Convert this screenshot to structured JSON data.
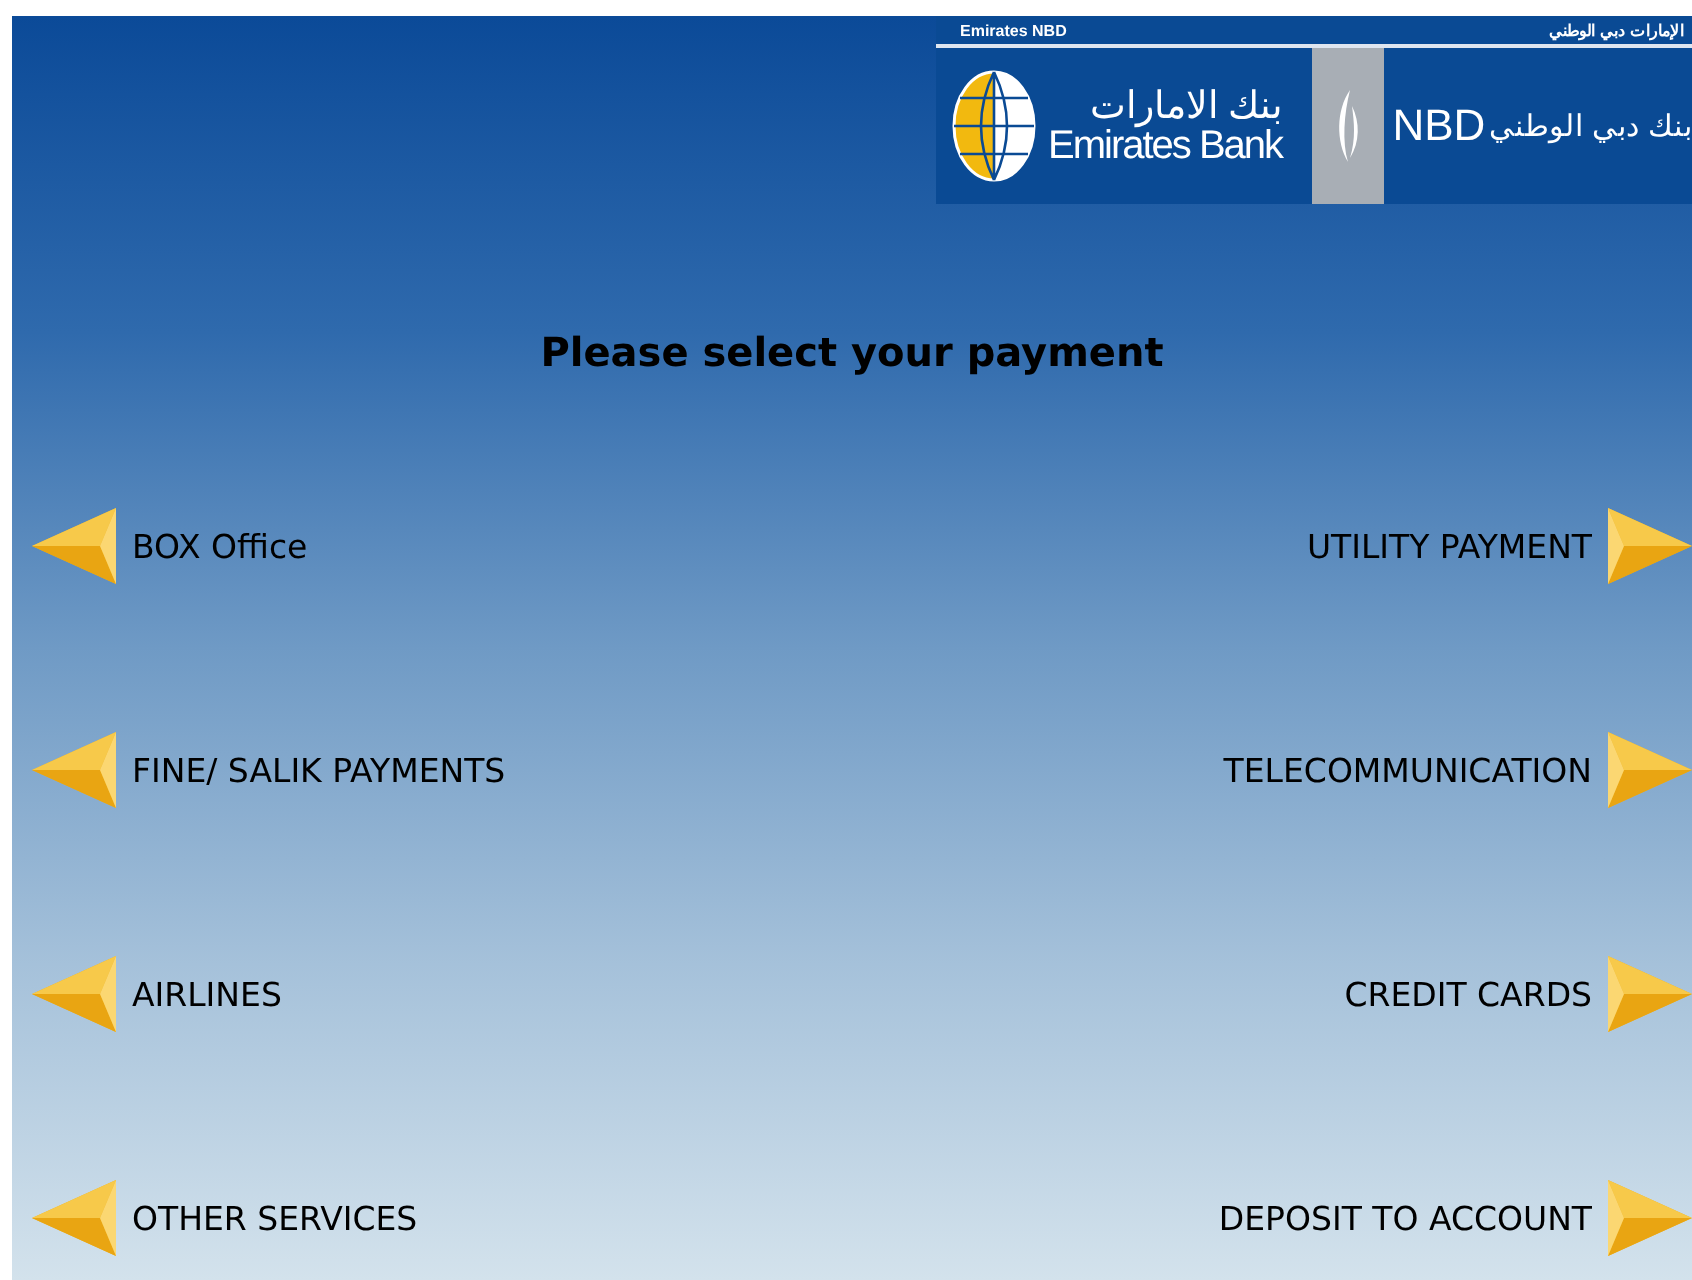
{
  "header": {
    "brand_en": "Emirates NBD",
    "brand_ar": "الإمارات دبي الوطني",
    "bank_ar": "بنك الامارات",
    "bank_en": "Emirates Bank",
    "nbd": "NBD",
    "nbd_ar": "بنك دبي الوطني"
  },
  "title": "Please select your payment",
  "left_options": [
    {
      "label": "BOX Office"
    },
    {
      "label": "FINE/ SALIK PAYMENTS"
    },
    {
      "label": "AIRLINES"
    },
    {
      "label": "OTHER SERVICES"
    }
  ],
  "right_options": [
    {
      "label": "UTILITY PAYMENT"
    },
    {
      "label": "TELECOMMUNICATION"
    },
    {
      "label": "CREDIT CARDS"
    },
    {
      "label": "DEPOSIT TO ACCOUNT"
    }
  ]
}
